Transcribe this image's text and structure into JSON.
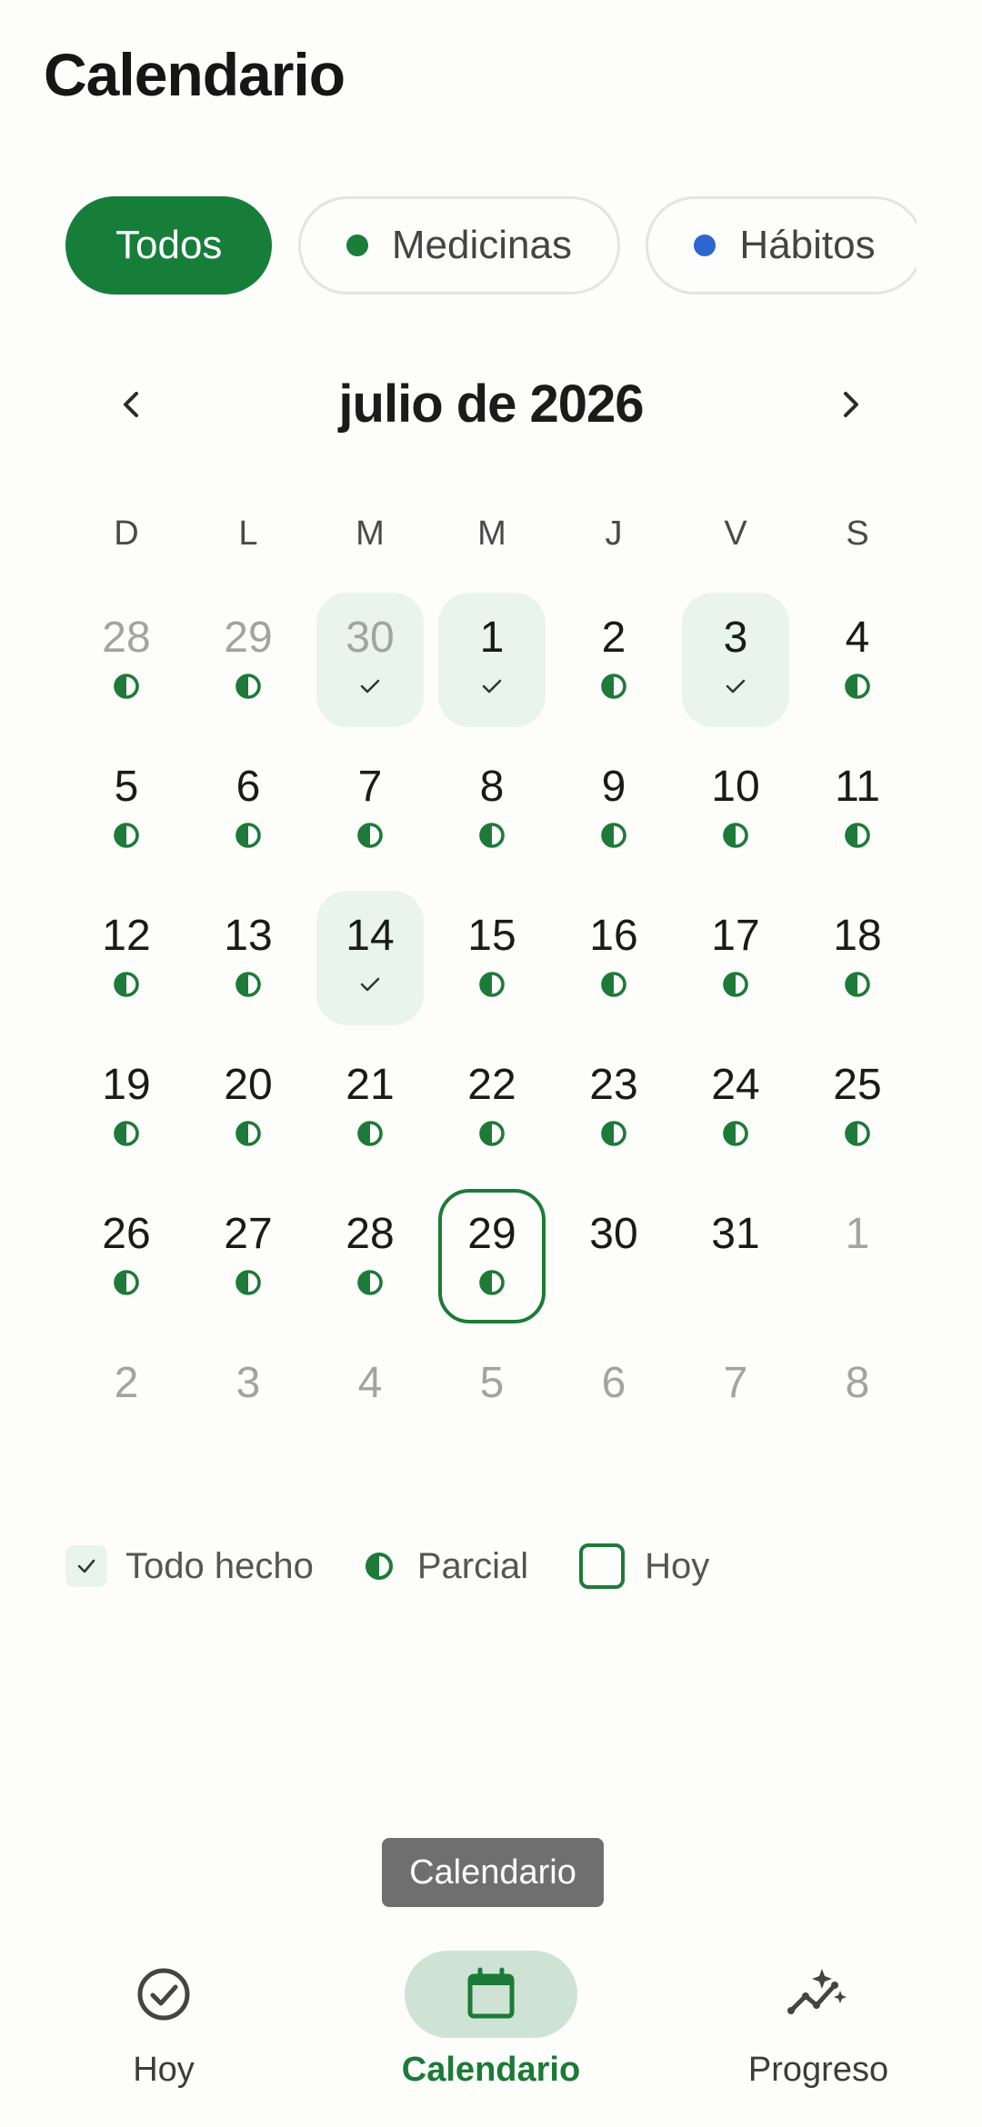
{
  "title": "Calendario",
  "filters": [
    {
      "label": "Todos",
      "active": true,
      "dot_color": null
    },
    {
      "label": "Medicinas",
      "active": false,
      "dot_color": "#1a7e3a"
    },
    {
      "label": "Hábitos",
      "active": false,
      "dot_color": "#2d66d0"
    }
  ],
  "calendar": {
    "month_label": "julio de 2026",
    "weekdays": [
      "D",
      "L",
      "M",
      "M",
      "J",
      "V",
      "S"
    ],
    "weeks": [
      [
        {
          "n": "28",
          "muted": true,
          "status": "partial"
        },
        {
          "n": "29",
          "muted": true,
          "status": "partial"
        },
        {
          "n": "30",
          "muted": true,
          "status": "done"
        },
        {
          "n": "1",
          "status": "done"
        },
        {
          "n": "2",
          "status": "partial"
        },
        {
          "n": "3",
          "status": "done"
        },
        {
          "n": "4",
          "status": "partial"
        }
      ],
      [
        {
          "n": "5",
          "status": "partial"
        },
        {
          "n": "6",
          "status": "partial"
        },
        {
          "n": "7",
          "status": "partial"
        },
        {
          "n": "8",
          "status": "partial"
        },
        {
          "n": "9",
          "status": "partial"
        },
        {
          "n": "10",
          "status": "partial"
        },
        {
          "n": "11",
          "status": "partial"
        }
      ],
      [
        {
          "n": "12",
          "status": "partial"
        },
        {
          "n": "13",
          "status": "partial"
        },
        {
          "n": "14",
          "status": "done"
        },
        {
          "n": "15",
          "status": "partial"
        },
        {
          "n": "16",
          "status": "partial"
        },
        {
          "n": "17",
          "status": "partial"
        },
        {
          "n": "18",
          "status": "partial"
        }
      ],
      [
        {
          "n": "19",
          "status": "partial"
        },
        {
          "n": "20",
          "status": "partial"
        },
        {
          "n": "21",
          "status": "partial"
        },
        {
          "n": "22",
          "status": "partial"
        },
        {
          "n": "23",
          "status": "partial"
        },
        {
          "n": "24",
          "status": "partial"
        },
        {
          "n": "25",
          "status": "partial"
        }
      ],
      [
        {
          "n": "26",
          "status": "partial"
        },
        {
          "n": "27",
          "status": "partial"
        },
        {
          "n": "28",
          "status": "partial"
        },
        {
          "n": "29",
          "status": "partial",
          "today": true
        },
        {
          "n": "30",
          "status": "none"
        },
        {
          "n": "31",
          "status": "none"
        },
        {
          "n": "1",
          "muted": true,
          "status": "none"
        }
      ],
      [
        {
          "n": "2",
          "muted": true,
          "status": "none"
        },
        {
          "n": "3",
          "muted": true,
          "status": "none"
        },
        {
          "n": "4",
          "muted": true,
          "status": "none"
        },
        {
          "n": "5",
          "muted": true,
          "status": "none"
        },
        {
          "n": "6",
          "muted": true,
          "status": "none"
        },
        {
          "n": "7",
          "muted": true,
          "status": "none"
        },
        {
          "n": "8",
          "muted": true,
          "status": "none"
        }
      ]
    ]
  },
  "legend": {
    "done_label": "Todo hecho",
    "partial_label": "Parcial",
    "today_label": "Hoy"
  },
  "tooltip": "Calendario",
  "nav": [
    {
      "label": "Hoy",
      "icon": "check-circle-icon",
      "active": false
    },
    {
      "label": "Calendario",
      "icon": "calendar-icon",
      "active": true
    },
    {
      "label": "Progreso",
      "icon": "trend-sparkle-icon",
      "active": false
    }
  ],
  "colors": {
    "accent": "#177e3a",
    "done_bg": "#e9f4ec",
    "muted_text": "#a3a3a3",
    "nav_active_bg": "#cfe3d4"
  }
}
